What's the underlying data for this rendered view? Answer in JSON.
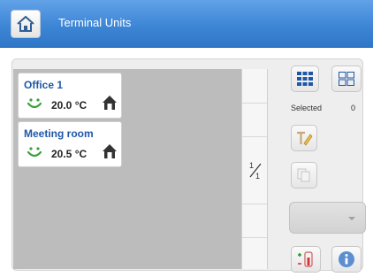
{
  "header": {
    "title": "Terminal Units"
  },
  "tiles": [
    {
      "name": "Office 1",
      "temperature": "20.0 °C"
    },
    {
      "name": "Meeting room",
      "temperature": "20.5 °C"
    }
  ],
  "selection": {
    "label": "Selected",
    "count": "0"
  },
  "icons": {
    "home": "home-icon",
    "comfort": "smiley-icon",
    "occupancy": "occupied-home-icon",
    "view_large": "large-grid-icon",
    "view_small": "small-grid-icon",
    "rename": "rename-icon",
    "copy": "copy-icon",
    "setpoint": "thermometer-icon",
    "info": "info-icon"
  },
  "colors": {
    "header": "#3d86d6",
    "accent_blue": "#1f57a8",
    "comfort_green": "#3aa13a"
  }
}
